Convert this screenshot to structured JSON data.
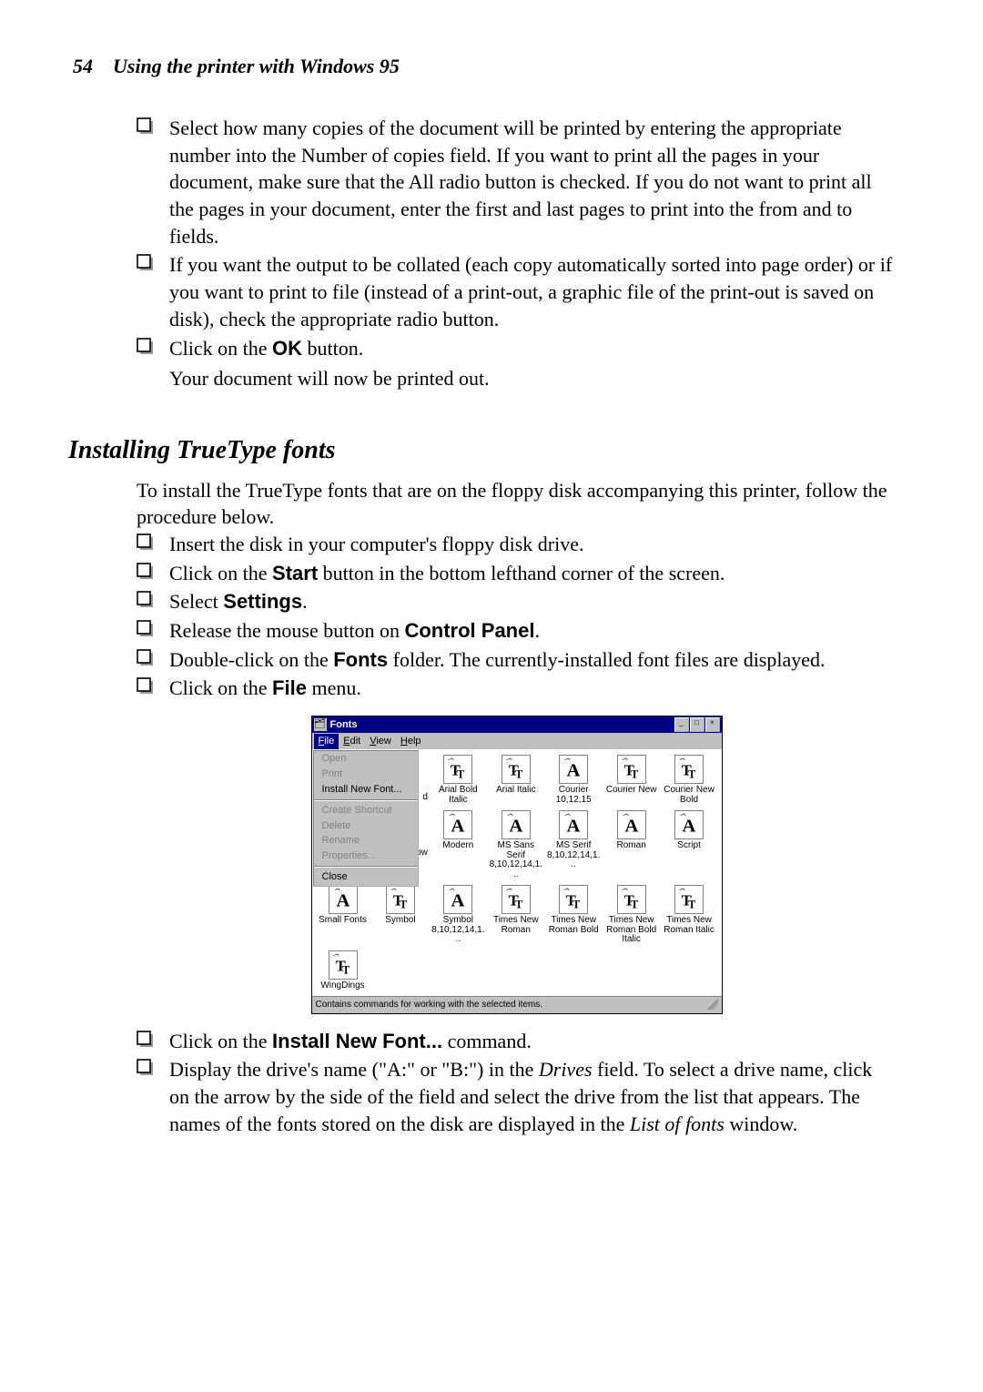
{
  "page": {
    "number": 54,
    "title": "Using the printer with Windows 95"
  },
  "para": {
    "b1": "Select how many copies of the document will be printed by entering the appropriate number into the Number of copies field. If you want to print all the pages in your document, make sure that the All radio button is checked. If you do not want to print all the pages in your document, enter the first and last pages to print into the from and to fields.",
    "b2": "If you want the output to be collated (each copy automatically sorted into page order) or if you want to print to file (instead of a print-out, a graphic file of the print-out is saved on disk), check the appropriate radio button.",
    "b3_pre": "Click on the ",
    "b3_bold": "OK",
    "b3_post": " button.",
    "after1": "Your document will now be printed out.",
    "h2": "Installing TrueType fonts",
    "intro2": "To install the TrueType fonts that are on the floppy disk accompanying this printer, follow the procedure below.",
    "s1": "Insert the disk in your computer's floppy disk drive.",
    "s2_pre": "Click on the ",
    "s2_bold": "Start",
    "s2_post": " button in the bottom lefthand corner of the screen.",
    "s3_pre": "Select ",
    "s3_bold": "Settings",
    "s3_post": ".",
    "s4_pre": "Release the mouse button on ",
    "s4_bold": "Control Panel",
    "s4_post": ".",
    "s5_pre": "Double-click on the ",
    "s5_bold": "Fonts",
    "s5_post": " folder. The currently-installed font files are displayed.",
    "s6_pre": "Click on the ",
    "s6_bold": "File",
    "s6_post": " menu.",
    "s7_pre": "Click on the ",
    "s7_bold": "Install New Font...",
    "s7_post": " command.",
    "s8_a": "Display the drive's name (\"A:\" or \"B:\") in the ",
    "s8_i1": "Drives",
    "s8_b": " field. To select a drive name, click on the arrow by the side of the field and select the drive from the list that appears. The names of the fonts stored on the disk are displayed in the ",
    "s8_i2": "List of fonts",
    "s8_c": " window."
  },
  "screenshot": {
    "title": "Fonts",
    "menubar": {
      "file": "File",
      "edit": "Edit",
      "view": "View",
      "help": "Help"
    },
    "dropdown": {
      "open": "Open",
      "print": "Print",
      "install": "Install New Font...",
      "shortcut": "Create Shortcut",
      "delete": "Delete",
      "rename": "Rename",
      "properties": "Properties...",
      "close": "Close"
    },
    "fonts": {
      "r1c3": "Arial Bold Italic",
      "r1c4": "Arial Italic",
      "r1c5": "Courier 10,12,15",
      "r1c6": "Courier New",
      "r1c7": "Courier New Bold",
      "r2c3": "Modern",
      "r2c4": "MS Sans Serif 8,10,12,14,1...",
      "r2c5": "MS Serif 8,10,12,14,1...",
      "r2c6": "Roman",
      "r2c7": "Script",
      "r3c1": "Small Fonts",
      "r3c2": "Symbol",
      "r3c3": "Symbol 8,10,12,14,1...",
      "r3c4": "Times New Roman",
      "r3c5": "Times New Roman Bold",
      "r3c6": "Times New Roman Bold Italic",
      "r3c7": "Times New Roman Italic",
      "r4c1": "WingDings"
    },
    "status": "Contains commands for working with the selected items."
  }
}
